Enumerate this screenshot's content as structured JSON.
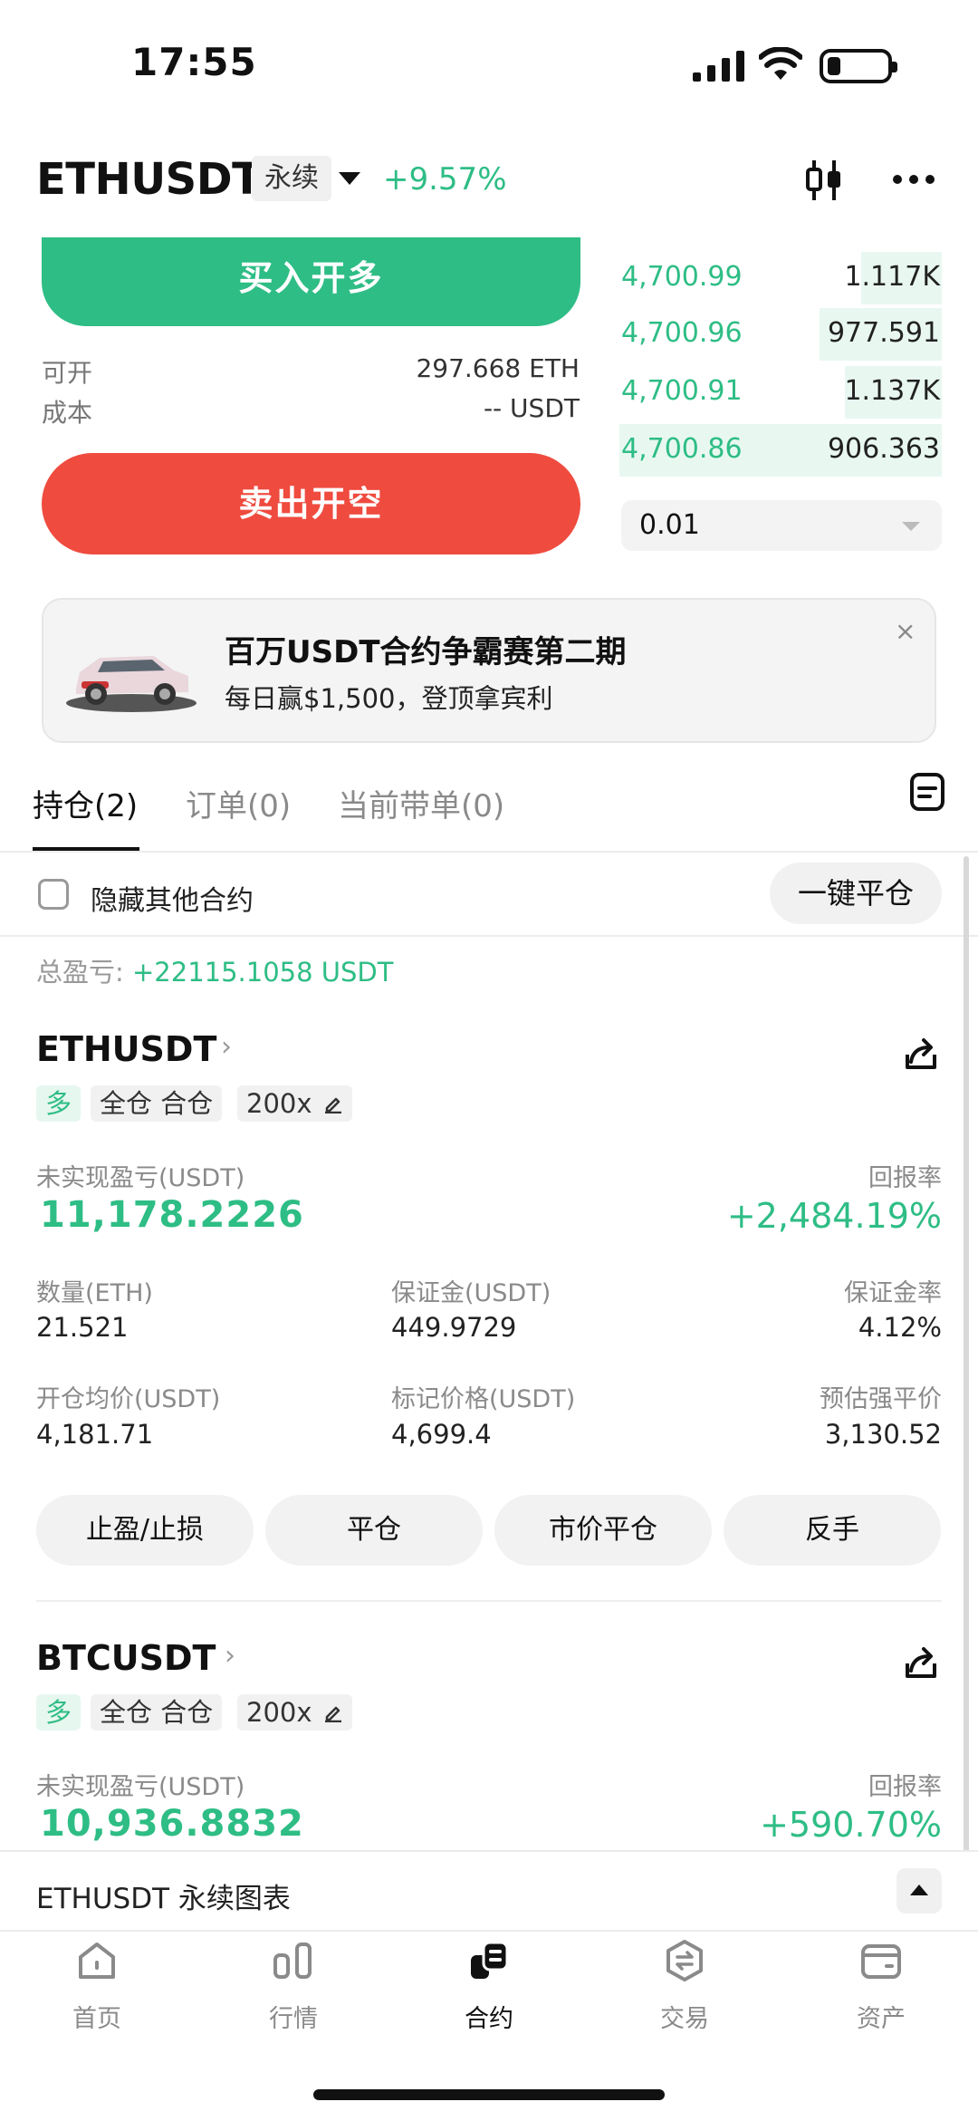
{
  "status_bar": {
    "time": "17:55"
  },
  "header": {
    "symbol": "ETHUSDT",
    "contract_type": "永续",
    "change": "+9.57%"
  },
  "trade": {
    "buy_label": "买入开多",
    "sell_label": "卖出开空",
    "available_label": "可开",
    "available_value": "297.668 ETH",
    "cost_label": "成本",
    "cost_value": "-- USDT"
  },
  "orderbook": {
    "rows": [
      {
        "price": "4,700.99",
        "qty": "1.117K",
        "depth": 0.25
      },
      {
        "price": "4,700.96",
        "qty": "977.591",
        "depth": 0.38
      },
      {
        "price": "4,700.91",
        "qty": "1.137K",
        "depth": 0.3
      },
      {
        "price": "4,700.86",
        "qty": "906.363",
        "depth": 1.0
      }
    ],
    "step": "0.01"
  },
  "banner": {
    "title": "百万USDT合约争霸赛第二期",
    "subtitle": "每日赢$1,500，登顶拿宾利",
    "close": "×"
  },
  "tabs": [
    {
      "label": "持仓(2)"
    },
    {
      "label": "订单(0)"
    },
    {
      "label": "当前带单(0)"
    }
  ],
  "positions_header": {
    "hide_label": "隐藏其他合约",
    "close_all": "一键平仓",
    "total_pnl_label": "总盈亏: ",
    "total_pnl_value": "+22115.1058 USDT"
  },
  "positions": [
    {
      "symbol": "ETHUSDT",
      "side": "多",
      "margin_mode": "全仓 合仓",
      "leverage": "200x",
      "pnl_label": "未实现盈亏(USDT)",
      "pnl": "11,178.2226",
      "roe_label": "回报率",
      "roe": "+2,484.19%",
      "qty_label": "数量(ETH)",
      "qty": "21.521",
      "margin_label": "保证金(USDT)",
      "margin": "449.9729",
      "margin_ratio_label": "保证金率",
      "margin_ratio": "4.12%",
      "entry_label": "开仓均价(USDT)",
      "entry": "4,181.71",
      "mark_label": "标记价格(USDT)",
      "mark": "4,699.4",
      "liq_label": "预估强平价",
      "liq": "3,130.52",
      "actions": [
        "止盈/止损",
        "平仓",
        "市价平仓",
        "反手"
      ]
    },
    {
      "symbol": "BTCUSDT",
      "side": "多",
      "margin_mode": "全仓 合仓",
      "leverage": "200x",
      "pnl_label": "未实现盈亏(USDT)",
      "pnl": "10,936.8832",
      "roe_label": "回报率",
      "roe": "+590.70%"
    }
  ],
  "chart_bar": {
    "label": "ETHUSDT 永续图表"
  },
  "nav": [
    {
      "label": "首页",
      "icon": "home-icon"
    },
    {
      "label": "行情",
      "icon": "market-icon"
    },
    {
      "label": "合约",
      "icon": "futures-icon"
    },
    {
      "label": "交易",
      "icon": "trade-icon"
    },
    {
      "label": "资产",
      "icon": "wallet-icon"
    }
  ]
}
